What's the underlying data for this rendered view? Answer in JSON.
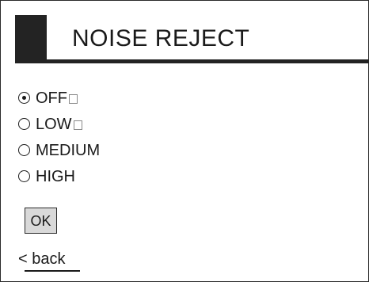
{
  "dialog": {
    "title": "NOISE REJECT"
  },
  "options": [
    {
      "label": "OFF",
      "selected": true,
      "has_box": true
    },
    {
      "label": "LOW",
      "selected": false,
      "has_box": true
    },
    {
      "label": "MEDIUM",
      "selected": false,
      "has_box": false
    },
    {
      "label": "HIGH",
      "selected": false,
      "has_box": false
    }
  ],
  "ok_button": {
    "label": "OK"
  },
  "back_link": {
    "label": "< back"
  },
  "colors": {
    "title_bar": "#232323",
    "button_bg": "#d9d9d9",
    "text": "#1a1a1a"
  }
}
